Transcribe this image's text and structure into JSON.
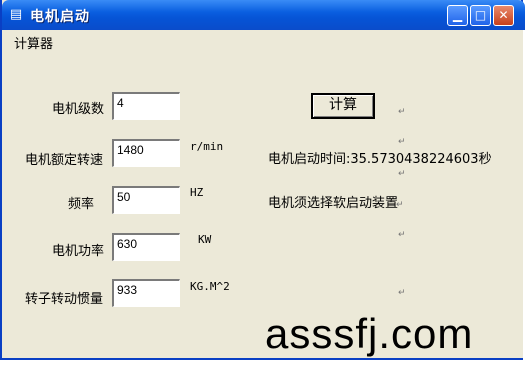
{
  "window": {
    "title": "电机启动"
  },
  "menu": {
    "items": [
      "计算器"
    ]
  },
  "form": {
    "fields": [
      {
        "label": "电机级数",
        "value": "4",
        "unit": ""
      },
      {
        "label": "电机额定转速",
        "value": "1480",
        "unit": "r/min"
      },
      {
        "label": "频率",
        "value": "50",
        "unit": "HZ"
      },
      {
        "label": "电机功率",
        "value": "630",
        "unit": "KW"
      },
      {
        "label": "转子转动惯量",
        "value": "933",
        "unit": "KG.M^2"
      }
    ],
    "calc_button": "计算"
  },
  "results": {
    "start_time": "电机启动时间:35.5730438224603秒",
    "advice": "电机须选择软启动装置"
  },
  "paragraph_mark": "↵",
  "watermark": "asssfj.com",
  "colors": {
    "titlebar": "#0a5fe0",
    "window_bg": "#ece9d8",
    "close_btn": "#c7401c"
  }
}
